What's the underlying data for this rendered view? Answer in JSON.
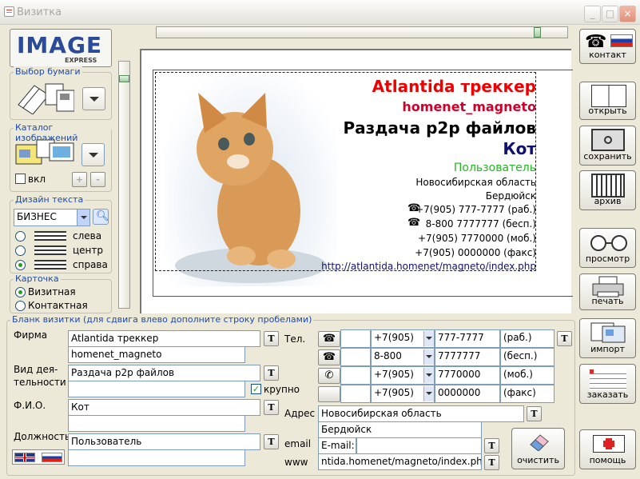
{
  "window": {
    "title": "Визитка",
    "min": "_",
    "max": "□",
    "close": "×"
  },
  "logo": {
    "main": "IMAGE",
    "sub": "EXPRESS"
  },
  "groups": {
    "paper": "Выбор бумаги",
    "catalog": "Каталог изображений",
    "design": "Дизайн текста",
    "card": "Карточка",
    "form": "Бланк визитки (для сдвига влево дополните строку пробелами)"
  },
  "catalog": {
    "checkbox_label": "вкл",
    "plus": "+",
    "minus": "-"
  },
  "design": {
    "font": "БИЗНЕС",
    "align_left": "слева",
    "align_center": "центр",
    "align_right": "справа"
  },
  "card_type": {
    "visit": "Визитная",
    "contact": "Контактная"
  },
  "card": {
    "company": "Atlantida треккер",
    "company2": "homenet_magneto",
    "activity": "Раздача p2p файлов",
    "name": "Кот",
    "position": "Пользователь",
    "addr1": "Новосибирская область",
    "addr2": "Бердюйск",
    "phone1": "+7(905) 777-7777 (раб.)",
    "phone2": "8-800 7777777 (бесп.)",
    "phone3": "+7(905) 7770000 (моб.)",
    "phone4": "+7(905) 0000000 (факс)",
    "url": "http://atlantida.homenet/magneto/index.php",
    "colors": {
      "company": "#ee0000",
      "company2": "#d0002a",
      "activity": "#000000",
      "name": "#101070",
      "position": "#22b822"
    }
  },
  "form": {
    "label_firm": "Фирма",
    "label_activity": "Вид дея-\nтельности",
    "label_fio": "Ф.И.О.",
    "label_position": "Должность",
    "firm": "Atlantida треккер",
    "firm2": "homenet_magneto",
    "activity": "Раздача p2p файлов",
    "activity2": "",
    "bold_label": "крупно",
    "fio": "Кот",
    "fio2": "",
    "position": "Пользователь",
    "position2": "",
    "label_tel": "Тел.",
    "label_addr": "Адрес",
    "label_email": "email",
    "label_www": "www",
    "phones": [
      {
        "code": "+7(905)",
        "num": "777-7777",
        "type": "(раб.)"
      },
      {
        "code": "8-800",
        "num": "7777777",
        "type": "(бесп.)"
      },
      {
        "code": "+7(905)",
        "num": "7770000",
        "type": "(моб.)"
      },
      {
        "code": "+7(905)",
        "num": "0000000",
        "type": "(факс)"
      }
    ],
    "addr1": "Новосибирская область",
    "addr2": "Бердюйск",
    "email_prefix": "E-mail:",
    "email": "",
    "www": "ntida.homenet/magneto/index.php",
    "t": "T"
  },
  "right_buttons": {
    "contact": "контакт",
    "open": "открыть",
    "save": "сохранить",
    "archive": "архив",
    "preview": "просмотр",
    "print": "печать",
    "import": "импорт",
    "order": "заказать",
    "help": "помощь"
  },
  "clear_button": "очистить",
  "icons": [
    "app-icon",
    "paper-icon",
    "gallery-icon",
    "zoom-icon",
    "cat-photo",
    "phone-icon",
    "mobile-icon",
    "fax-icon",
    "book-icon",
    "safe-icon",
    "archive-icon",
    "glasses-icon",
    "printer-icon",
    "import-icon",
    "order-icon",
    "first-aid-icon",
    "eraser-icon",
    "flag-uk-icon",
    "flag-ru-icon"
  ]
}
